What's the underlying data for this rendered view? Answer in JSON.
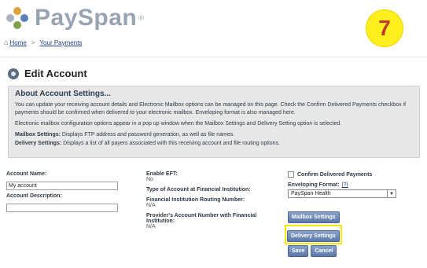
{
  "header": {
    "logo_text": "PaySpan",
    "logo_reg": "®",
    "breadcrumb": [
      {
        "label": "Home"
      },
      {
        "label": "Your Payments"
      }
    ],
    "breadcrumb_sep": ">",
    "step_badge": "7"
  },
  "page": {
    "title": "Edit Account"
  },
  "about": {
    "heading": "About Account Settings...",
    "p1": "You can update your receiving account details and Electronic Mailbox options can be managed on this page. Check the Confirm Delivered Payments checkbox if payments should be confirmed when delivered to your electronic mailbox. Enveloping format is also managed here.",
    "p2": "Electronic mailbox configuration options appear in a pop up window when the Mailbox Settings and Delivery Setting option is selected.",
    "p3_label": "Mailbox Settings:",
    "p3_text": " Displays FTP address and password generation, as well as file names.",
    "p4_label": "Delivery Settings:",
    "p4_text": " Displays a list of all payers associated with this receiving account and file routing options."
  },
  "form": {
    "account_name_label": "Account Name:",
    "account_name_value": "My account",
    "account_desc_label": "Account Description:",
    "account_desc_value": "",
    "enable_eft_label": "Enable EFT:",
    "enable_eft_value": "No",
    "account_type_label": "Type of Account at Financial Institution:",
    "routing_label": "Financial Institution Routing Number:",
    "routing_value": "N/A",
    "provider_acct_label": "Provider's Account Number with Financial Institution:",
    "provider_acct_value": "N/A",
    "confirm_label": "Confirm Delivered Payments",
    "enveloping_label": "Enveloping Format:",
    "help_label": "[?]",
    "enveloping_value": "PaySpan Health"
  },
  "buttons": {
    "mailbox": "Mailbox Settings",
    "delivery": "Delivery Settings",
    "save": "Save",
    "cancel": "Cancel"
  },
  "colors": {
    "accent": "#5b78a8",
    "highlight": "#f4e60f",
    "badge": "#ffef1f"
  }
}
